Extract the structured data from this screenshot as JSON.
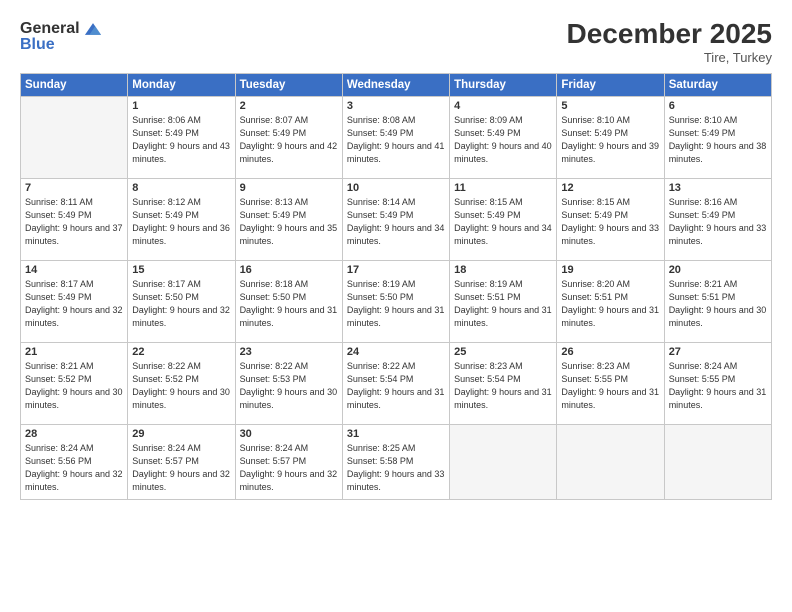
{
  "logo": {
    "general": "General",
    "blue": "Blue"
  },
  "title": "December 2025",
  "location": "Tire, Turkey",
  "days_of_week": [
    "Sunday",
    "Monday",
    "Tuesday",
    "Wednesday",
    "Thursday",
    "Friday",
    "Saturday"
  ],
  "weeks": [
    [
      {
        "day": "",
        "empty": true
      },
      {
        "day": "1",
        "sunrise": "8:06 AM",
        "sunset": "5:49 PM",
        "daylight": "9 hours and 43 minutes."
      },
      {
        "day": "2",
        "sunrise": "8:07 AM",
        "sunset": "5:49 PM",
        "daylight": "9 hours and 42 minutes."
      },
      {
        "day": "3",
        "sunrise": "8:08 AM",
        "sunset": "5:49 PM",
        "daylight": "9 hours and 41 minutes."
      },
      {
        "day": "4",
        "sunrise": "8:09 AM",
        "sunset": "5:49 PM",
        "daylight": "9 hours and 40 minutes."
      },
      {
        "day": "5",
        "sunrise": "8:10 AM",
        "sunset": "5:49 PM",
        "daylight": "9 hours and 39 minutes."
      },
      {
        "day": "6",
        "sunrise": "8:10 AM",
        "sunset": "5:49 PM",
        "daylight": "9 hours and 38 minutes."
      }
    ],
    [
      {
        "day": "7",
        "sunrise": "8:11 AM",
        "sunset": "5:49 PM",
        "daylight": "9 hours and 37 minutes."
      },
      {
        "day": "8",
        "sunrise": "8:12 AM",
        "sunset": "5:49 PM",
        "daylight": "9 hours and 36 minutes."
      },
      {
        "day": "9",
        "sunrise": "8:13 AM",
        "sunset": "5:49 PM",
        "daylight": "9 hours and 35 minutes."
      },
      {
        "day": "10",
        "sunrise": "8:14 AM",
        "sunset": "5:49 PM",
        "daylight": "9 hours and 34 minutes."
      },
      {
        "day": "11",
        "sunrise": "8:15 AM",
        "sunset": "5:49 PM",
        "daylight": "9 hours and 34 minutes."
      },
      {
        "day": "12",
        "sunrise": "8:15 AM",
        "sunset": "5:49 PM",
        "daylight": "9 hours and 33 minutes."
      },
      {
        "day": "13",
        "sunrise": "8:16 AM",
        "sunset": "5:49 PM",
        "daylight": "9 hours and 33 minutes."
      }
    ],
    [
      {
        "day": "14",
        "sunrise": "8:17 AM",
        "sunset": "5:49 PM",
        "daylight": "9 hours and 32 minutes."
      },
      {
        "day": "15",
        "sunrise": "8:17 AM",
        "sunset": "5:50 PM",
        "daylight": "9 hours and 32 minutes."
      },
      {
        "day": "16",
        "sunrise": "8:18 AM",
        "sunset": "5:50 PM",
        "daylight": "9 hours and 31 minutes."
      },
      {
        "day": "17",
        "sunrise": "8:19 AM",
        "sunset": "5:50 PM",
        "daylight": "9 hours and 31 minutes."
      },
      {
        "day": "18",
        "sunrise": "8:19 AM",
        "sunset": "5:51 PM",
        "daylight": "9 hours and 31 minutes."
      },
      {
        "day": "19",
        "sunrise": "8:20 AM",
        "sunset": "5:51 PM",
        "daylight": "9 hours and 31 minutes."
      },
      {
        "day": "20",
        "sunrise": "8:21 AM",
        "sunset": "5:51 PM",
        "daylight": "9 hours and 30 minutes."
      }
    ],
    [
      {
        "day": "21",
        "sunrise": "8:21 AM",
        "sunset": "5:52 PM",
        "daylight": "9 hours and 30 minutes."
      },
      {
        "day": "22",
        "sunrise": "8:22 AM",
        "sunset": "5:52 PM",
        "daylight": "9 hours and 30 minutes."
      },
      {
        "day": "23",
        "sunrise": "8:22 AM",
        "sunset": "5:53 PM",
        "daylight": "9 hours and 30 minutes."
      },
      {
        "day": "24",
        "sunrise": "8:22 AM",
        "sunset": "5:54 PM",
        "daylight": "9 hours and 31 minutes."
      },
      {
        "day": "25",
        "sunrise": "8:23 AM",
        "sunset": "5:54 PM",
        "daylight": "9 hours and 31 minutes."
      },
      {
        "day": "26",
        "sunrise": "8:23 AM",
        "sunset": "5:55 PM",
        "daylight": "9 hours and 31 minutes."
      },
      {
        "day": "27",
        "sunrise": "8:24 AM",
        "sunset": "5:55 PM",
        "daylight": "9 hours and 31 minutes."
      }
    ],
    [
      {
        "day": "28",
        "sunrise": "8:24 AM",
        "sunset": "5:56 PM",
        "daylight": "9 hours and 32 minutes."
      },
      {
        "day": "29",
        "sunrise": "8:24 AM",
        "sunset": "5:57 PM",
        "daylight": "9 hours and 32 minutes."
      },
      {
        "day": "30",
        "sunrise": "8:24 AM",
        "sunset": "5:57 PM",
        "daylight": "9 hours and 32 minutes."
      },
      {
        "day": "31",
        "sunrise": "8:25 AM",
        "sunset": "5:58 PM",
        "daylight": "9 hours and 33 minutes."
      },
      {
        "day": "",
        "empty": true
      },
      {
        "day": "",
        "empty": true
      },
      {
        "day": "",
        "empty": true
      }
    ]
  ],
  "labels": {
    "sunrise": "Sunrise:",
    "sunset": "Sunset:",
    "daylight": "Daylight:"
  }
}
